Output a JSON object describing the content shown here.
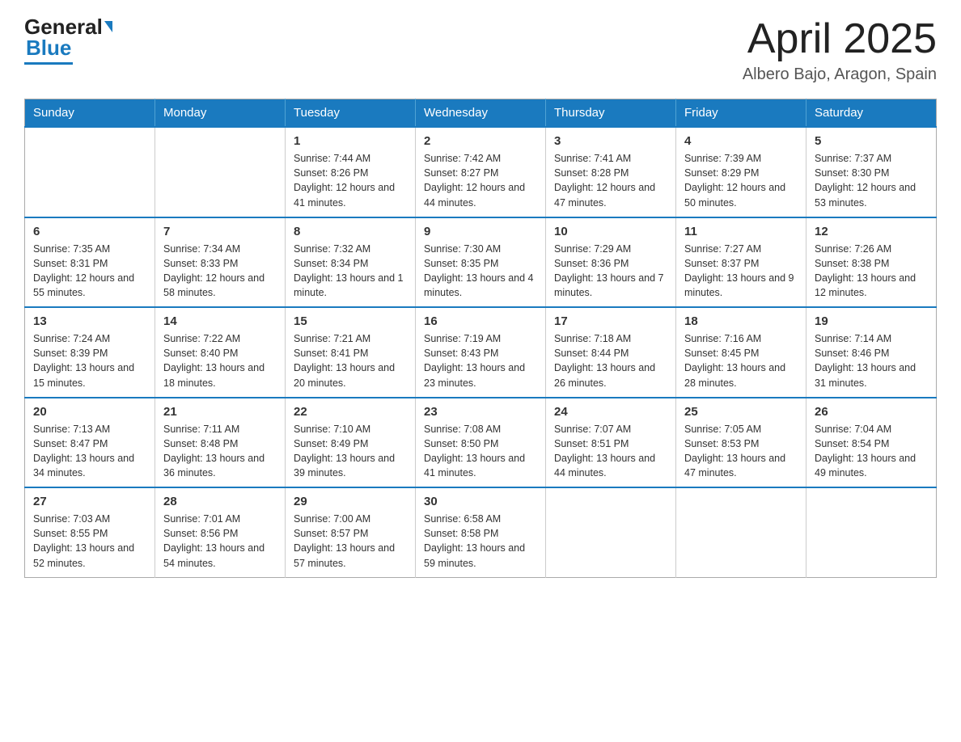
{
  "header": {
    "logo": {
      "part1": "General",
      "part2": "Blue"
    },
    "title": "April 2025",
    "location": "Albero Bajo, Aragon, Spain"
  },
  "calendar": {
    "days_of_week": [
      "Sunday",
      "Monday",
      "Tuesday",
      "Wednesday",
      "Thursday",
      "Friday",
      "Saturday"
    ],
    "weeks": [
      [
        {
          "day": "",
          "info": ""
        },
        {
          "day": "",
          "info": ""
        },
        {
          "day": "1",
          "info": "Sunrise: 7:44 AM\nSunset: 8:26 PM\nDaylight: 12 hours\nand 41 minutes."
        },
        {
          "day": "2",
          "info": "Sunrise: 7:42 AM\nSunset: 8:27 PM\nDaylight: 12 hours\nand 44 minutes."
        },
        {
          "day": "3",
          "info": "Sunrise: 7:41 AM\nSunset: 8:28 PM\nDaylight: 12 hours\nand 47 minutes."
        },
        {
          "day": "4",
          "info": "Sunrise: 7:39 AM\nSunset: 8:29 PM\nDaylight: 12 hours\nand 50 minutes."
        },
        {
          "day": "5",
          "info": "Sunrise: 7:37 AM\nSunset: 8:30 PM\nDaylight: 12 hours\nand 53 minutes."
        }
      ],
      [
        {
          "day": "6",
          "info": "Sunrise: 7:35 AM\nSunset: 8:31 PM\nDaylight: 12 hours\nand 55 minutes."
        },
        {
          "day": "7",
          "info": "Sunrise: 7:34 AM\nSunset: 8:33 PM\nDaylight: 12 hours\nand 58 minutes."
        },
        {
          "day": "8",
          "info": "Sunrise: 7:32 AM\nSunset: 8:34 PM\nDaylight: 13 hours\nand 1 minute."
        },
        {
          "day": "9",
          "info": "Sunrise: 7:30 AM\nSunset: 8:35 PM\nDaylight: 13 hours\nand 4 minutes."
        },
        {
          "day": "10",
          "info": "Sunrise: 7:29 AM\nSunset: 8:36 PM\nDaylight: 13 hours\nand 7 minutes."
        },
        {
          "day": "11",
          "info": "Sunrise: 7:27 AM\nSunset: 8:37 PM\nDaylight: 13 hours\nand 9 minutes."
        },
        {
          "day": "12",
          "info": "Sunrise: 7:26 AM\nSunset: 8:38 PM\nDaylight: 13 hours\nand 12 minutes."
        }
      ],
      [
        {
          "day": "13",
          "info": "Sunrise: 7:24 AM\nSunset: 8:39 PM\nDaylight: 13 hours\nand 15 minutes."
        },
        {
          "day": "14",
          "info": "Sunrise: 7:22 AM\nSunset: 8:40 PM\nDaylight: 13 hours\nand 18 minutes."
        },
        {
          "day": "15",
          "info": "Sunrise: 7:21 AM\nSunset: 8:41 PM\nDaylight: 13 hours\nand 20 minutes."
        },
        {
          "day": "16",
          "info": "Sunrise: 7:19 AM\nSunset: 8:43 PM\nDaylight: 13 hours\nand 23 minutes."
        },
        {
          "day": "17",
          "info": "Sunrise: 7:18 AM\nSunset: 8:44 PM\nDaylight: 13 hours\nand 26 minutes."
        },
        {
          "day": "18",
          "info": "Sunrise: 7:16 AM\nSunset: 8:45 PM\nDaylight: 13 hours\nand 28 minutes."
        },
        {
          "day": "19",
          "info": "Sunrise: 7:14 AM\nSunset: 8:46 PM\nDaylight: 13 hours\nand 31 minutes."
        }
      ],
      [
        {
          "day": "20",
          "info": "Sunrise: 7:13 AM\nSunset: 8:47 PM\nDaylight: 13 hours\nand 34 minutes."
        },
        {
          "day": "21",
          "info": "Sunrise: 7:11 AM\nSunset: 8:48 PM\nDaylight: 13 hours\nand 36 minutes."
        },
        {
          "day": "22",
          "info": "Sunrise: 7:10 AM\nSunset: 8:49 PM\nDaylight: 13 hours\nand 39 minutes."
        },
        {
          "day": "23",
          "info": "Sunrise: 7:08 AM\nSunset: 8:50 PM\nDaylight: 13 hours\nand 41 minutes."
        },
        {
          "day": "24",
          "info": "Sunrise: 7:07 AM\nSunset: 8:51 PM\nDaylight: 13 hours\nand 44 minutes."
        },
        {
          "day": "25",
          "info": "Sunrise: 7:05 AM\nSunset: 8:53 PM\nDaylight: 13 hours\nand 47 minutes."
        },
        {
          "day": "26",
          "info": "Sunrise: 7:04 AM\nSunset: 8:54 PM\nDaylight: 13 hours\nand 49 minutes."
        }
      ],
      [
        {
          "day": "27",
          "info": "Sunrise: 7:03 AM\nSunset: 8:55 PM\nDaylight: 13 hours\nand 52 minutes."
        },
        {
          "day": "28",
          "info": "Sunrise: 7:01 AM\nSunset: 8:56 PM\nDaylight: 13 hours\nand 54 minutes."
        },
        {
          "day": "29",
          "info": "Sunrise: 7:00 AM\nSunset: 8:57 PM\nDaylight: 13 hours\nand 57 minutes."
        },
        {
          "day": "30",
          "info": "Sunrise: 6:58 AM\nSunset: 8:58 PM\nDaylight: 13 hours\nand 59 minutes."
        },
        {
          "day": "",
          "info": ""
        },
        {
          "day": "",
          "info": ""
        },
        {
          "day": "",
          "info": ""
        }
      ]
    ]
  }
}
